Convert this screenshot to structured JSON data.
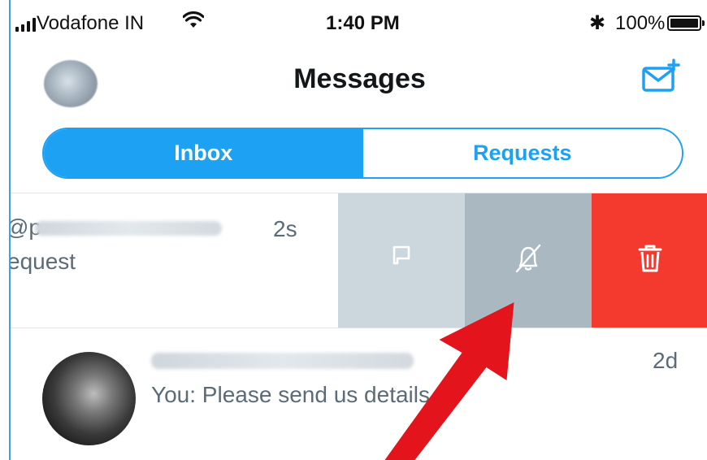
{
  "status_bar": {
    "carrier": "Vodafone IN",
    "time": "1:40 PM",
    "bluetooth": "✱",
    "battery": "100%"
  },
  "header": {
    "title": "Messages"
  },
  "tabs": [
    {
      "label": "Inbox",
      "active": true
    },
    {
      "label": "Requests",
      "active": false
    }
  ],
  "conversations": [
    {
      "handle_prefix": "@p",
      "time": "2s",
      "snippet": "equest",
      "actions": [
        "flag-icon",
        "mute-notifications-icon",
        "trash-icon"
      ]
    },
    {
      "time": "2d",
      "snippet": "You: Please send us details at"
    }
  ],
  "colors": {
    "accent": "#1da1f2",
    "delete": "#f43a2f",
    "flag_bg": "#ccd6dd",
    "mute_bg": "#aab8c2",
    "annotation_arrow": "#e3141b"
  }
}
